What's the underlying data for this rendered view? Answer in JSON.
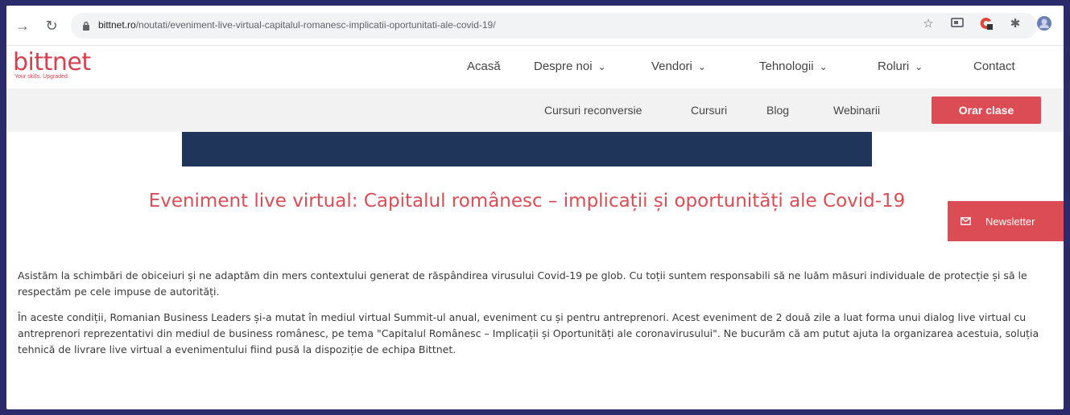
{
  "browser": {
    "url_host": "bittnet.ro",
    "url_path": "/noutati/eveniment-live-virtual-capitalul-romanesc-implicatii-oportunitati-ale-covid-19/"
  },
  "site": {
    "logo": "bittnet",
    "tagline": "Your skills. Upgraded."
  },
  "main_nav": [
    "Acasă",
    "Despre noi",
    "Vendori",
    "Tehnologii",
    "Roluri",
    "Contact"
  ],
  "sub_nav": [
    "Cursuri reconversie",
    "Cursuri",
    "Blog",
    "Webinarii"
  ],
  "cta_button": "Orar clase",
  "newsletter": "Newsletter",
  "article": {
    "title": "Eveniment live virtual: Capitalul românesc – implicații și oportunități ale Covid-19",
    "paragraphs": [
      "Asistăm la schimbări de obiceiuri și ne adaptăm din mers contextului generat de răspândirea virusului Covid-19 pe glob. Cu toții suntem responsabili să ne luăm măsuri individuale de protecție și să le respectăm pe cele impuse de autorități.",
      "În aceste condiții, Romanian Business Leaders și-a mutat în mediul virtual Summit-ul anual, eveniment cu și pentru antreprenori. Acest eveniment de 2 două zile a luat forma unui dialog live virtual cu antreprenori reprezentativi din mediul de business românesc, pe tema \"Capitalul Românesc – Implicații și Oportunități ale coronavirusului\". Ne bucurăm că am putut ajuta la organizarea acestuia, soluția tehnică de livrare live virtual a evenimentului fiind pusă la dispoziție de echipa Bittnet."
    ]
  },
  "colors": {
    "brand_red": "#dc4c55",
    "banner_navy": "#1f3559",
    "frame_border": "#2b2a6b"
  }
}
